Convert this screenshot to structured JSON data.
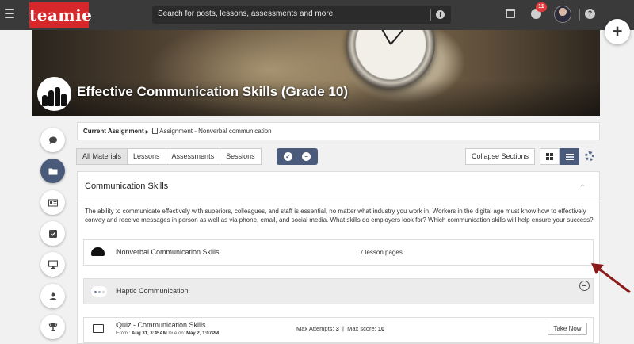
{
  "topbar": {
    "logo_text": "teamie",
    "search_placeholder": "Search for posts, lessons, assessments and more",
    "notifications_count": "11"
  },
  "banner": {
    "title": "Effective Communication Skills (Grade 10)"
  },
  "assignment_bar": {
    "label": "Current Assignment",
    "value": "Assignment - Nonverbal communication"
  },
  "tabs": [
    "All Materials",
    "Lessons",
    "Assessments",
    "Sessions"
  ],
  "controls": {
    "collapse_label": "Collapse Sections"
  },
  "section": {
    "title": "Communication Skills",
    "description": "The ability to communicate effectively with superiors, colleagues, and staff is essential, no matter what industry you work in. Workers in the digital age must know how to effectively convey and receive messages in person as well as via phone, email, and social media. What skills do employers look for? Which communication skills will help ensure your success?",
    "items": [
      {
        "title": "Nonverbal Communication Skills",
        "meta": "7 lesson pages"
      },
      {
        "title": "Haptic Communication"
      }
    ],
    "quiz": {
      "title": "Quiz - Communication Skills",
      "from_label": "From::",
      "from_value": "Aug 31, 3:45AM",
      "due_label": "Due on:",
      "due_value": "May 2, 1:07PM",
      "attempts_label": "Max Attempts:",
      "attempts_value": "3",
      "score_label": "Max score:",
      "score_value": "10",
      "action_label": "Take Now"
    }
  },
  "colors": {
    "topbar": "#3a3a3a",
    "brand_red": "#d6282b",
    "accent": "#4a5a7a",
    "annotation_arrow": "#8b1a1a"
  }
}
